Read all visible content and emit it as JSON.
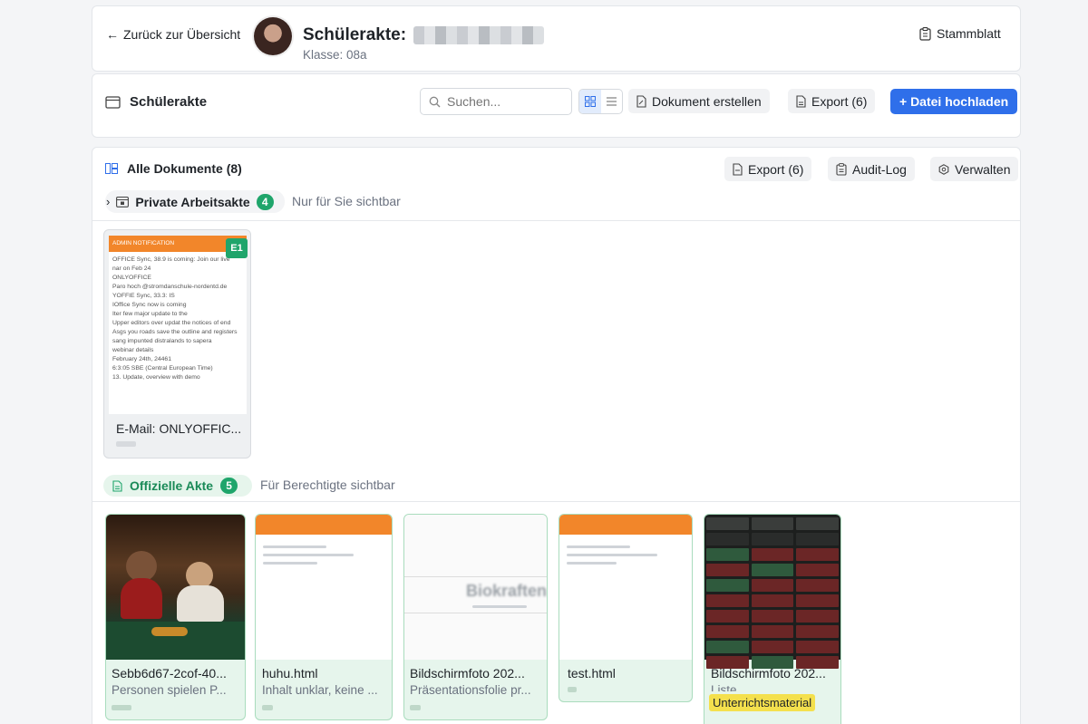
{
  "header": {
    "back_label": "Zurück zur Übersicht",
    "title": "Schülerakte:",
    "subtitle": "Klasse: 08a",
    "stammblatt_label": "Stammblatt"
  },
  "toolbar": {
    "section_label": "Schülerakte",
    "search_placeholder": "Suchen...",
    "create_label": "Dokument erstellen",
    "export_label": "Export (6)",
    "upload_label": "+ Datei hochladen"
  },
  "docs_header": {
    "title": "Alle Dokumente (8)",
    "export_label": "Export (6)",
    "audit_label": "Audit-Log",
    "manage_label": "Verwalten"
  },
  "private": {
    "label": "Private Arbeitsakte",
    "count": "4",
    "note": "Nur für Sie sichtbar",
    "items": [
      {
        "title": "E-Mail: ONLYOFFIC...",
        "badge": "E1",
        "header_text": "ADMIN NOTIFICATION",
        "preview_lines": [
          "OFFICE Sync, 38.9 is coming: Join our live",
          "nar on Feb 24",
          "ONLYOFFICE",
          "Paro hoch @stromdanschule-nordentd.de",
          "YOFFIE Sync, 33.3: IS",
          "IOffice Sync now is coming",
          "Iter few major update to the",
          "Upper editors over updat the notices of end",
          "Asgs you roads save the outline and registers",
          "sang impunted distralands to sapera",
          "webinar details",
          "February 24th, 24461",
          "6:3:05 SBE (Central European Time)",
          "13. Update, overview with demo"
        ]
      }
    ]
  },
  "official": {
    "label": "Offizielle Akte",
    "count": "5",
    "note": "Für Berechtigte sichtbar",
    "items": [
      {
        "title": "Sebb6d67-2cof-40...",
        "desc": "Personen spielen P..."
      },
      {
        "title": "huhu.html",
        "desc": "Inhalt unklar, keine ..."
      },
      {
        "title": "Bildschirmfoto 202...",
        "desc": "Präsentationsfolie pr...",
        "preview_text": "Biokraften"
      },
      {
        "title": "test.html",
        "desc": ""
      },
      {
        "title": "Bildschirmfoto 202...",
        "desc": "Liste",
        "tag": "Unterrichtsmaterial"
      }
    ]
  },
  "colors": {
    "primary": "#2f6fea",
    "green": "#1fa56b",
    "green_bg": "#e6f5ec",
    "orange": "#f2862a",
    "tag_yellow": "#f4e04d"
  }
}
